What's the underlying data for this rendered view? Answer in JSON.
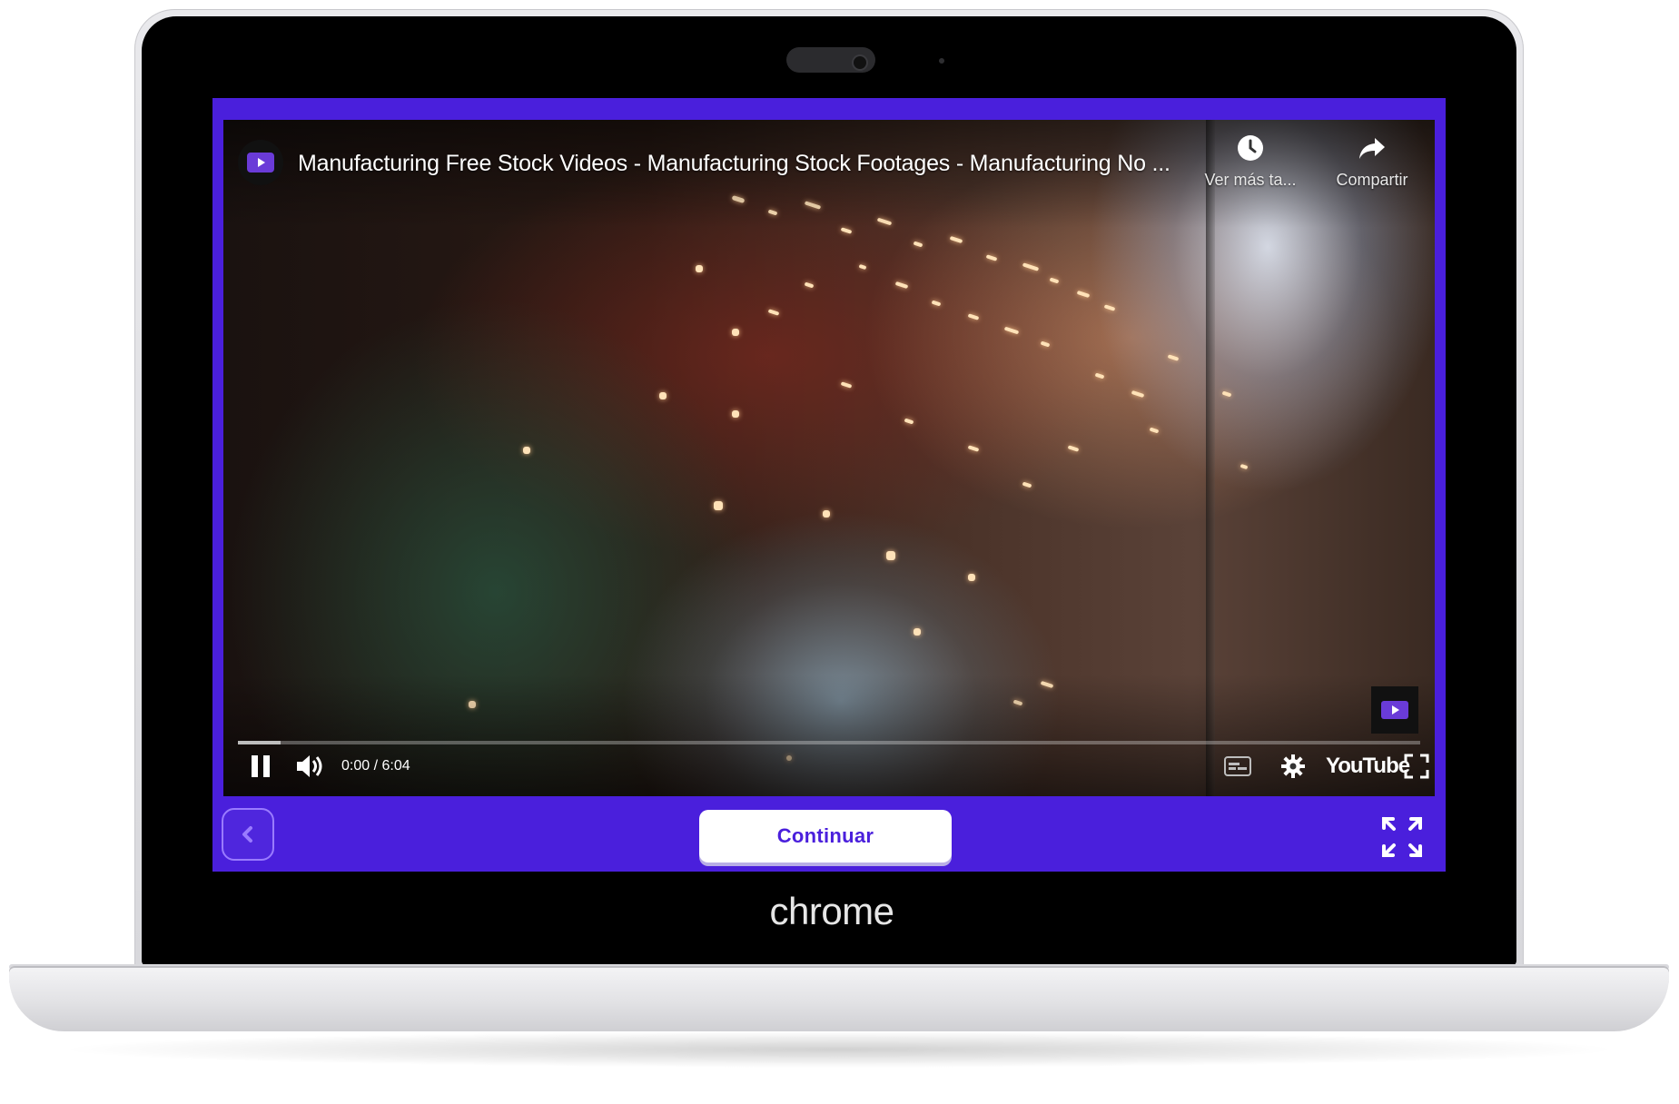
{
  "player": {
    "title": "Manufacturing Free Stock Videos - Manufacturing Stock Footages - Manufacturing No ...",
    "watch_later_label": "Ver más ta...",
    "share_label": "Compartir",
    "time": "0:00 / 6:04",
    "progress_fraction": 0.036,
    "youtube_label": "YouTube",
    "icons": {
      "channel": "channel-avatar-icon",
      "watch_later": "clock-icon",
      "share": "share-arrow-icon",
      "pause": "pause-icon",
      "volume": "volume-icon",
      "captions": "captions-icon",
      "settings": "gear-icon",
      "fullscreen": "fullscreen-icon",
      "watermark": "channel-watermark-icon"
    }
  },
  "nav": {
    "continue_label": "Continuar",
    "back_icon": "chevron-left-icon",
    "expand_icon": "expand-icon"
  },
  "device": {
    "brand": "chrome"
  },
  "colors": {
    "accent": "#4a1fdc",
    "bezel": "#000000",
    "button_text": "#4a1fdc"
  }
}
